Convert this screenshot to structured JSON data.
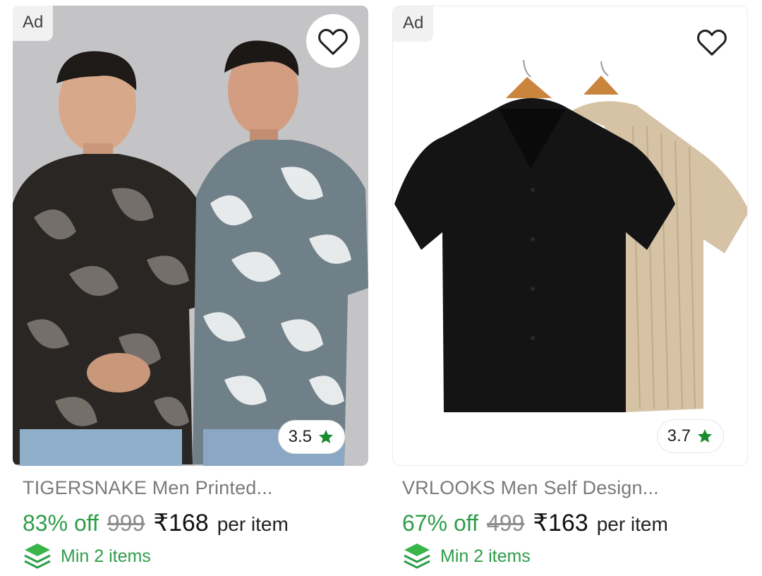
{
  "products": [
    {
      "ad_label": "Ad",
      "rating": "3.5",
      "title": "TIGERSNAKE Men Printed...",
      "discount": "83% off",
      "mrp": "999",
      "price": "₹168",
      "per_unit": "per item",
      "min_qty": "Min 2 items"
    },
    {
      "ad_label": "Ad",
      "rating": "3.7",
      "title": "VRLOOKS Men Self Design...",
      "discount": "67% off",
      "mrp": "499",
      "price": "₹163",
      "per_unit": "per item",
      "min_qty": "Min 2 items"
    }
  ],
  "colors": {
    "discount_green": "#2e9e49",
    "star_green": "#1a8a2e",
    "title_gray": "#7a7a7a"
  },
  "icons": [
    "heart-outline-icon",
    "star-icon",
    "stacked-layers-icon"
  ]
}
